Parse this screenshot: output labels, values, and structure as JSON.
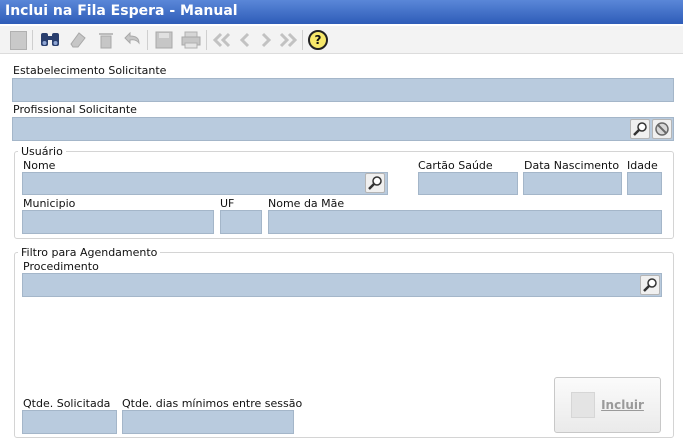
{
  "window": {
    "title": "Inclui na Fila Espera - Manual"
  },
  "toolbar": {
    "icons": [
      "new-icon",
      "search-icon",
      "eraser-icon",
      "delete-icon",
      "undo-icon",
      "save-icon",
      "print-icon",
      "first-icon",
      "prev-icon",
      "next-icon",
      "last-icon",
      "help-icon"
    ],
    "help_label": "?"
  },
  "form": {
    "estabelecimento_label": "Estabelecimento Solicitante",
    "estabelecimento_value": "",
    "profissional_label": "Profissional Solicitante",
    "profissional_value": ""
  },
  "usuario": {
    "group_title": "Usuário",
    "nome_label": "Nome",
    "cartao_label": "Cartão Saúde",
    "nascimento_label": "Data Nascimento",
    "idade_label": "Idade",
    "municipio_label": "Municipio",
    "uf_label": "UF",
    "mae_label": "Nome da Mãe"
  },
  "filtro": {
    "group_title": "Filtro para Agendamento",
    "procedimento_label": "Procedimento",
    "qtde_label": "Qtde.  Solicitada",
    "dias_label": "Qtde.  dias mínimos entre sessão"
  },
  "actions": {
    "incluir_label": "Incluir"
  },
  "colors": {
    "title_bar": "#3a68c4",
    "field_bg": "#b9cbde"
  }
}
